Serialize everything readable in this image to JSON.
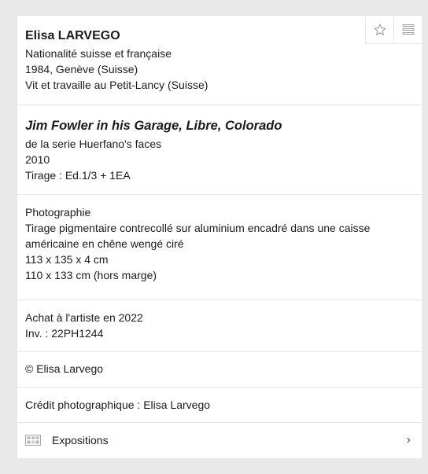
{
  "artist": {
    "name": "Elisa LARVEGO",
    "nationality": "Nationalité suisse et française",
    "birth": "1984, Genève (Suisse)",
    "residence": "Vit et travaille au Petit-Lancy (Suisse)"
  },
  "work": {
    "title": "Jim Fowler in his Garage, Libre, Colorado",
    "series": "de la serie Huerfano's faces",
    "year": "2010",
    "edition": "Tirage : Ed.1/3 + 1EA"
  },
  "technique": {
    "medium": "Photographie",
    "description": "Tirage pigmentaire contrecollé sur aluminium encadré dans une caisse américaine en chêne wengé ciré",
    "dimensions_framed": "113 x 135 x 4 cm",
    "dimensions_image": "110 x 133 cm (hors marge)"
  },
  "acquisition": {
    "purchase": "Achat à l'artiste en 2022",
    "inventory": "Inv. : 22PH1244"
  },
  "copyright": "© Elisa Larvego",
  "credit": "Crédit photographique : Elisa Larvego",
  "expositions": {
    "label": "Expositions",
    "icon": "exhibition-icon"
  },
  "toolbar": {
    "favorite_icon": "star-icon",
    "list_icon": "list-icon"
  }
}
